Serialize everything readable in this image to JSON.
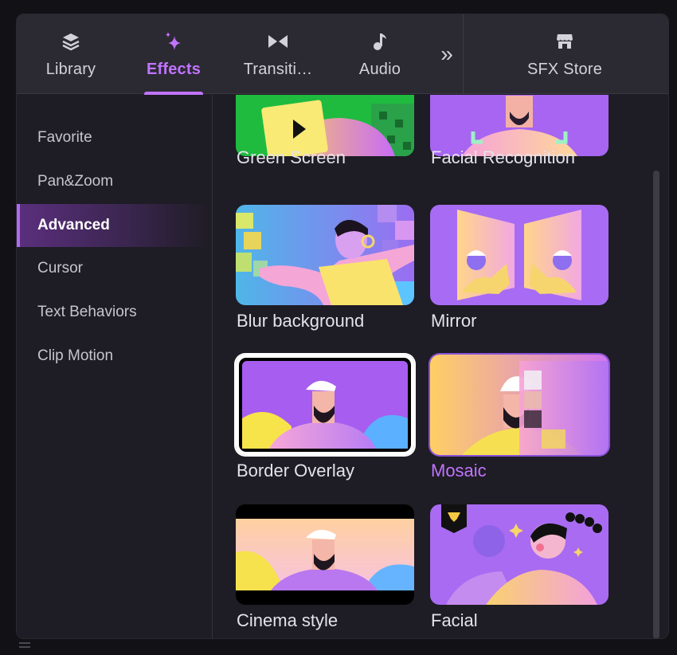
{
  "tabs": [
    {
      "id": "library",
      "label": "Library",
      "icon": "layers-icon",
      "active": false
    },
    {
      "id": "effects",
      "label": "Effects",
      "icon": "sparkle-icon",
      "active": true
    },
    {
      "id": "transitions",
      "label": "Transiti…",
      "icon": "bowtie-icon",
      "active": false
    },
    {
      "id": "audio",
      "label": "Audio",
      "icon": "music-note-icon",
      "active": false
    }
  ],
  "more_tabs": {
    "label": "»",
    "icon": "double-chevron-right-icon"
  },
  "store_tab": {
    "label": "SFX Store",
    "icon": "store-icon"
  },
  "sidebar": {
    "items": [
      {
        "label": "Favorite",
        "active": false
      },
      {
        "label": "Pan&Zoom",
        "active": false
      },
      {
        "label": "Advanced",
        "active": true
      },
      {
        "label": "Cursor",
        "active": false
      },
      {
        "label": "Text Behaviors",
        "active": false
      },
      {
        "label": "Clip Motion",
        "active": false
      }
    ]
  },
  "effects": [
    {
      "label": "Green Screen",
      "thumb": "green-screen"
    },
    {
      "label": "Facial Recognition",
      "thumb": "facial-recognition"
    },
    {
      "label": "Blur background",
      "thumb": "blur-background"
    },
    {
      "label": "Mirror",
      "thumb": "mirror"
    },
    {
      "label": "Border Overlay",
      "thumb": "border-overlay",
      "selected": true
    },
    {
      "label": "Mosaic",
      "thumb": "mosaic",
      "highlighted": true
    },
    {
      "label": "Cinema style",
      "thumb": "cinema-style"
    },
    {
      "label": "Facial",
      "thumb": "facial",
      "premium": true
    }
  ],
  "colors": {
    "accent": "#c074ff",
    "panel": "#1e1c24",
    "tabbar": "#2b2932"
  }
}
